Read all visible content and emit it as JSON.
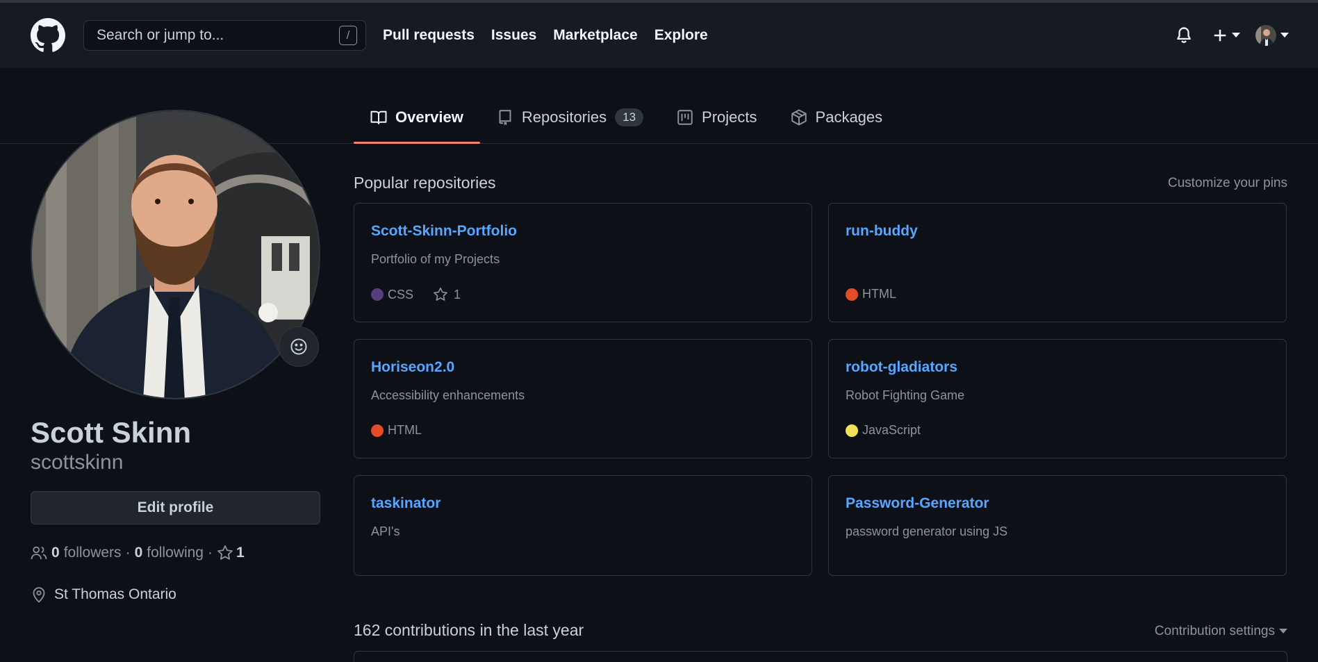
{
  "header": {
    "search_placeholder": "Search or jump to...",
    "search_shortcut": "/",
    "nav": [
      "Pull requests",
      "Issues",
      "Marketplace",
      "Explore"
    ],
    "icons": [
      "github-logo",
      "bell-icon",
      "plus-icon",
      "avatar"
    ]
  },
  "tabs": [
    {
      "label": "Overview",
      "icon": "book-icon",
      "active": true
    },
    {
      "label": "Repositories",
      "icon": "repo-icon",
      "count": "13"
    },
    {
      "label": "Projects",
      "icon": "project-icon"
    },
    {
      "label": "Packages",
      "icon": "package-icon"
    }
  ],
  "profile": {
    "full_name": "Scott Skinn",
    "username": "scottskinn",
    "edit_label": "Edit profile",
    "followers_count": "0",
    "followers_label": "followers",
    "following_count": "0",
    "following_label": "following",
    "stars_count": "1",
    "location": "St Thomas Ontario"
  },
  "popular": {
    "title": "Popular repositories",
    "customize_label": "Customize your pins",
    "repos": [
      {
        "name": "Scott-Skinn-Portfolio",
        "description": "Portfolio of my Projects",
        "language": "CSS",
        "lang_color": "#563d7c",
        "stars": "1"
      },
      {
        "name": "run-buddy",
        "description": "",
        "language": "HTML",
        "lang_color": "#e34c26",
        "stars": ""
      },
      {
        "name": "Horiseon2.0",
        "description": "Accessibility enhancements",
        "language": "HTML",
        "lang_color": "#e34c26",
        "stars": ""
      },
      {
        "name": "robot-gladiators",
        "description": "Robot Fighting Game",
        "language": "JavaScript",
        "lang_color": "#f1e05a",
        "stars": ""
      },
      {
        "name": "taskinator",
        "description": "API's",
        "language": "",
        "lang_color": "",
        "stars": ""
      },
      {
        "name": "Password-Generator",
        "description": "password generator using JS",
        "language": "",
        "lang_color": "",
        "stars": ""
      }
    ]
  },
  "contributions": {
    "title": "162 contributions in the last year",
    "settings_label": "Contribution settings"
  }
}
